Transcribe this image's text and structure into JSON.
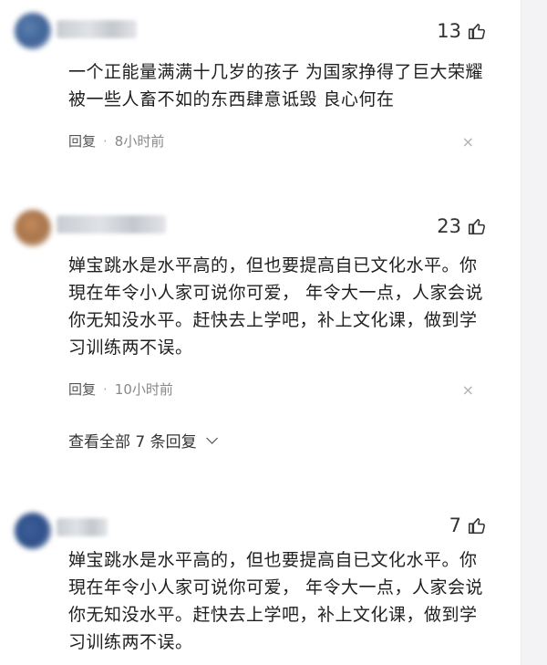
{
  "comments": [
    {
      "likes": "13",
      "text_lines": [
        "一个正能量满满十几岁的孩子 为国家挣得了巨大荣耀",
        "被一些人畜不如的东西肆意诋毁 良心何在"
      ],
      "reply_label": "回复",
      "time": "8小时前",
      "close": "×"
    },
    {
      "likes": "23",
      "text_lines": [
        "婵宝跳水是水平高的，但也要提高自已文化水平。你",
        "現在年令小人家可说你可爱，  年令大一点，人家会说",
        "你无知没水平。赶快去上学吧，补上文化课，做到学",
        "习训练两不误。"
      ],
      "reply_label": "回复",
      "time": "10小时前",
      "close": "×",
      "view_replies": "查看全部 7 条回复"
    },
    {
      "likes": "7",
      "text_lines": [
        "婵宝跳水是水平高的，但也要提高自已文化水平。你",
        "現在年令小人家可说你可爱，  年令大一点，人家会说",
        "你无知没水平。赶快去上学吧，补上文化课，做到学",
        "习训练两不误。"
      ]
    }
  ],
  "icons": {
    "like": "thumbs-up-icon",
    "close": "close-icon",
    "expand": "chevron-down-icon"
  },
  "colors": {
    "text": "#1f1f1f",
    "meta": "#888888",
    "background": "#ffffff"
  }
}
